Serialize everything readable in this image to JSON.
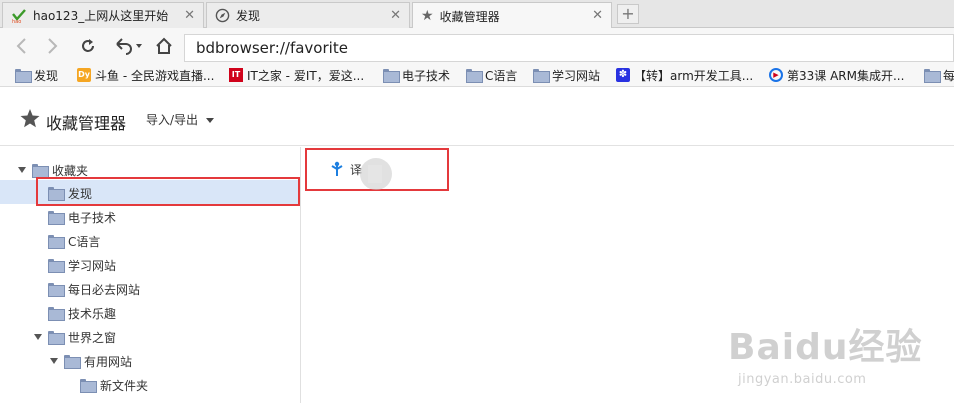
{
  "tabs": [
    {
      "title": "hao123_上网从这里开始",
      "icon": "hao123-icon"
    },
    {
      "title": "发现",
      "icon": "compass-icon"
    },
    {
      "title": "收藏管理器",
      "icon": "star-icon"
    }
  ],
  "new_tab_label": "+",
  "close_glyph": "✕",
  "address": "bdbrowser://favorite",
  "bookmarks": [
    {
      "label": "发现",
      "icon": "folder-icon"
    },
    {
      "label": "斗鱼 - 全民游戏直播...",
      "icon": "douyu-icon"
    },
    {
      "label": "IT之家 - 爱IT，爱这...",
      "icon": "ithome-icon"
    },
    {
      "label": "电子技术",
      "icon": "folder-icon"
    },
    {
      "label": "C语言",
      "icon": "folder-icon"
    },
    {
      "label": "学习网站",
      "icon": "folder-icon"
    },
    {
      "label": "【转】arm开发工具...",
      "icon": "baidu-paw-icon"
    },
    {
      "label": "第33课 ARM集成开...",
      "icon": "video-icon"
    },
    {
      "label": "每",
      "icon": "folder-icon"
    }
  ],
  "manager": {
    "title": "收藏管理器",
    "import_export": "导入/导出"
  },
  "tree": [
    {
      "label": "收藏夹",
      "expanded": true
    },
    {
      "label": "发现",
      "selected": true
    },
    {
      "label": "电子技术"
    },
    {
      "label": "C语言"
    },
    {
      "label": "学习网站"
    },
    {
      "label": "每日必去网站"
    },
    {
      "label": "技术乐趣"
    },
    {
      "label": "世界之窗",
      "expanded": true
    },
    {
      "label": "有用网站",
      "expanded": true
    },
    {
      "label": "新文件夹"
    }
  ],
  "entries": [
    {
      "label": "译",
      "icon": "share-icon"
    }
  ],
  "watermark": {
    "logo": "Baidu经验",
    "sub": "jingyan.baidu.com"
  },
  "colors": {
    "highlight": "#e4393c",
    "selection": "#d9e6f8",
    "folder": "#a9b9d6"
  }
}
